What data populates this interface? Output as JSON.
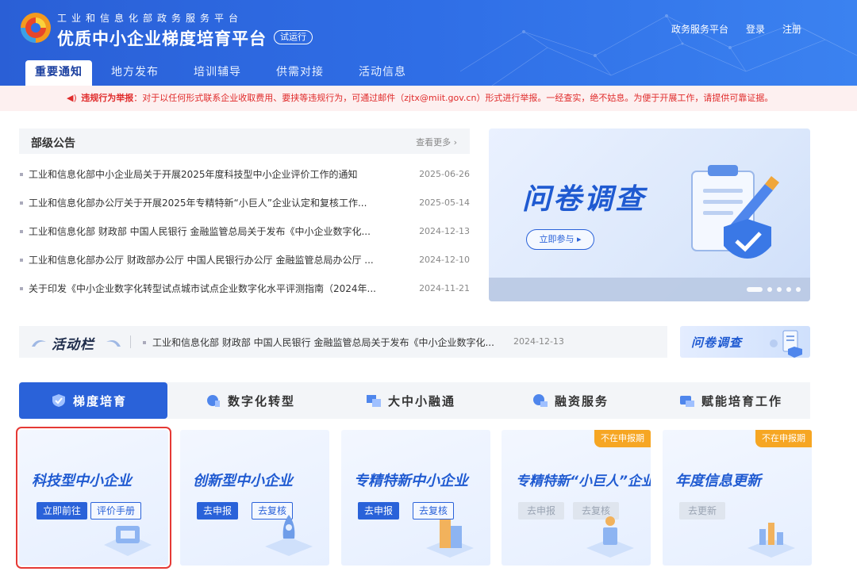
{
  "header": {
    "org_name": "工业和信息化部政务服务平台",
    "site_title": "优质中小企业梯度培育平台",
    "beta_badge": "试运行",
    "links": [
      "政务服务平台",
      "登录",
      "注册"
    ]
  },
  "nav": [
    "重要通知",
    "地方发布",
    "培训辅导",
    "供需对接",
    "活动信息"
  ],
  "alert": {
    "label": "违规行为举报",
    "text": "：对于以任何形式联系企业收取费用、要挟等违规行为，可通过邮件（zjtx@miit.gov.cn）形式进行举报。一经查实，绝不姑息。为便于开展工作，请提供可靠证据。"
  },
  "notices": {
    "title": "部级公告",
    "more": "查看更多 ›",
    "items": [
      {
        "title": "工业和信息化部中小企业局关于开展2025年度科技型中小企业评价工作的通知",
        "date": "2025-06-26"
      },
      {
        "title": "工业和信息化部办公厅关于开展2025年专精特新“小巨人”企业认定和复核工作...",
        "date": "2025-05-14"
      },
      {
        "title": "工业和信息化部 财政部 中国人民银行 金融监管总局关于发布《中小企业数字化...",
        "date": "2024-12-13"
      },
      {
        "title": "工业和信息化部办公厅 财政部办公厅 中国人民银行办公厅 金融监管总局办公厅 ...",
        "date": "2024-12-10"
      },
      {
        "title": "关于印发《中小企业数字化转型试点城市试点企业数字化水平评测指南（2024年...",
        "date": "2024-11-21"
      }
    ]
  },
  "banner": {
    "title": "问卷调查",
    "button": "立即参与 ▸"
  },
  "activity": {
    "title": "活动栏",
    "text": "工业和信息化部 财政部 中国人民银行 金融监管总局关于发布《中小企业数字化...",
    "date": "2024-12-13",
    "side_badge": "问卷调查"
  },
  "tabs": [
    "梯度培育",
    "数字化转型",
    "大中小融通",
    "融资服务",
    "赋能培育工作"
  ],
  "cards": [
    {
      "title": "科技型中小企业",
      "btn1": "立即前往",
      "btn2": "评价手册"
    },
    {
      "title": "创新型中小企业",
      "btn1": "去申报",
      "btn2": "去复核"
    },
    {
      "title": "专精特新中小企业",
      "btn1": "去申报",
      "btn2": "去复核"
    },
    {
      "title": "专精特新“小巨人”企业",
      "btn1": "去申报",
      "btn2": "去复核",
      "badge": "不在申报期"
    },
    {
      "title": "年度信息更新",
      "btn1": "去更新",
      "badge": "不在申报期"
    }
  ],
  "colors": {
    "brand": "#2a62d9",
    "alert": "#e02b2b",
    "badge": "#f6a623",
    "selection": "#e53935"
  }
}
